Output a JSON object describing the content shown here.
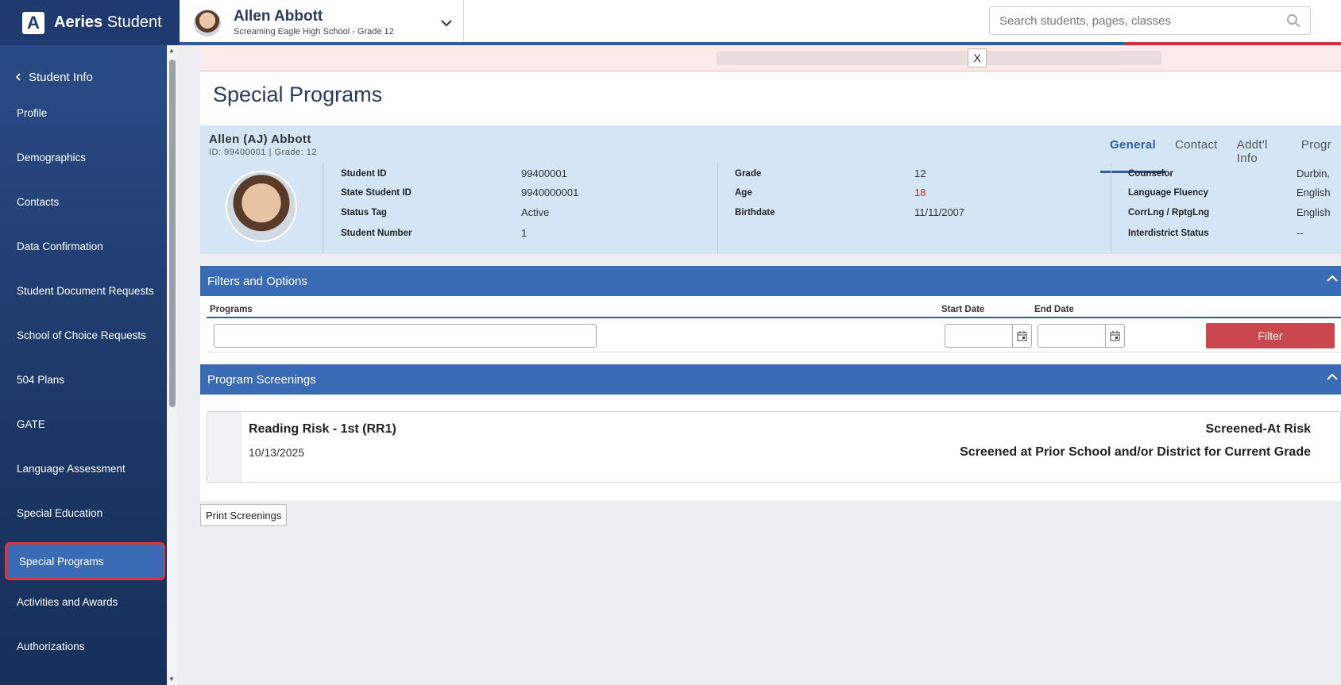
{
  "brand": {
    "logo_letter": "A",
    "name_bold": "Aeries",
    "name_light": "Student"
  },
  "student_switch": {
    "name": "Allen Abbott",
    "sub": "Screaming Eagle High School - Grade 12"
  },
  "search": {
    "placeholder": "Search students, pages, classes"
  },
  "sidebar": {
    "back_label": "Student Info",
    "items": [
      {
        "label": "Profile"
      },
      {
        "label": "Demographics"
      },
      {
        "label": "Contacts"
      },
      {
        "label": "Data Confirmation"
      },
      {
        "label": "Student Document Requests"
      },
      {
        "label": "School of Choice Requests"
      },
      {
        "label": "504 Plans"
      },
      {
        "label": "GATE"
      },
      {
        "label": "Language Assessment"
      },
      {
        "label": "Special Education"
      },
      {
        "label": "Special Programs",
        "active": true
      },
      {
        "label": "Activities and Awards"
      },
      {
        "label": "Authorizations"
      }
    ]
  },
  "notice": {
    "close_label": "X"
  },
  "page": {
    "title": "Special Programs"
  },
  "student": {
    "display_name": "Allen (AJ) Abbott",
    "id_line": "ID: 99400001 |  Grade: 12",
    "tabs": [
      "General",
      "Contact",
      "Addt'l Info",
      "Progr"
    ],
    "col1": [
      {
        "label": "Student ID",
        "value": "99400001"
      },
      {
        "label": "State Student ID",
        "value": "9940000001"
      },
      {
        "label": "Status Tag",
        "value": "Active"
      },
      {
        "label": "Student Number",
        "value": "1"
      }
    ],
    "col2": [
      {
        "label": "Grade",
        "value": "12"
      },
      {
        "label": "Age",
        "value": "18"
      },
      {
        "label": "Birthdate",
        "value": "11/11/2007"
      }
    ],
    "col3": [
      {
        "label": "Counselor",
        "value": "Durbin,"
      },
      {
        "label": "Language Fluency",
        "value": "English"
      },
      {
        "label": "CorrLng / RptgLng",
        "value": "English"
      },
      {
        "label": "Interdistrict Status",
        "value": "--"
      }
    ],
    "age_color": "#d41f1f"
  },
  "filters": {
    "title": "Filters and Options",
    "programs_label": "Programs",
    "start_label": "Start Date",
    "end_label": "End Date",
    "filter_button": "Filter"
  },
  "screenings": {
    "title": "Program Screenings",
    "items": [
      {
        "title": "Reading Risk - 1st (RR1)",
        "date": "10/13/2025",
        "status": "Screened-At Risk",
        "note": "Screened at Prior School and/or District for Current Grade"
      }
    ],
    "print_button": "Print Screenings"
  },
  "colors": {
    "brand_dark": "#1e3a6e",
    "section_blue": "#3a6cb6",
    "filter_red": "#c9474d"
  }
}
